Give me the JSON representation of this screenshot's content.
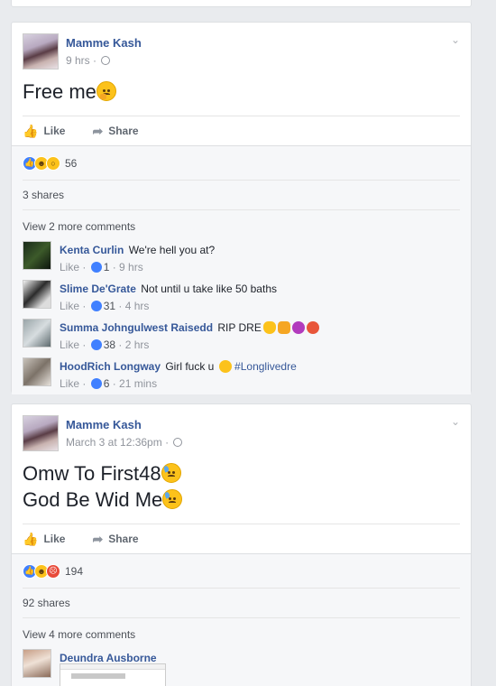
{
  "posts": [
    {
      "author": "Mamme Kash",
      "time": "9 hrs",
      "text": "Free me",
      "text_lines": [
        "Free me"
      ],
      "actions": {
        "like": "Like",
        "share": "Share"
      },
      "reaction_count": "56",
      "shares": "3 shares",
      "view_more": "View 2 more comments",
      "comments": [
        {
          "name": "Kenta Curlin",
          "text": "We're hell you at?",
          "like": "Like",
          "likes": "1",
          "time": "9 hrs"
        },
        {
          "name": "Slime De'Grate",
          "text": "Not until u take like 50 baths",
          "like": "Like",
          "likes": "31",
          "time": "4 hrs"
        },
        {
          "name": "Summa Johngulwest Raisedd",
          "text": "RIP DRE",
          "like": "Like",
          "likes": "38",
          "time": "2 hrs"
        },
        {
          "name": "HoodRich Longway",
          "text": "Girl fuck u",
          "hashtag": "#Longlivedre",
          "like": "Like",
          "likes": "6",
          "time": "21 mins"
        }
      ]
    },
    {
      "author": "Mamme Kash",
      "time": "March 3 at 12:36pm",
      "text_lines": [
        "Omw To First48",
        "God Be Wid Me"
      ],
      "actions": {
        "like": "Like",
        "share": "Share"
      },
      "reaction_count": "194",
      "shares": "92 shares",
      "view_more": "View 4 more comments",
      "comments": [
        {
          "name": "Deundra Ausborne"
        }
      ]
    }
  ],
  "icons": {
    "like": "thumbs-up-icon",
    "share": "share-arrow-icon",
    "privacy": "globe-icon",
    "menu": "chevron-down-icon"
  },
  "colors": {
    "link": "#365899",
    "like_blue": "#4080ff",
    "muted": "#90949c"
  }
}
